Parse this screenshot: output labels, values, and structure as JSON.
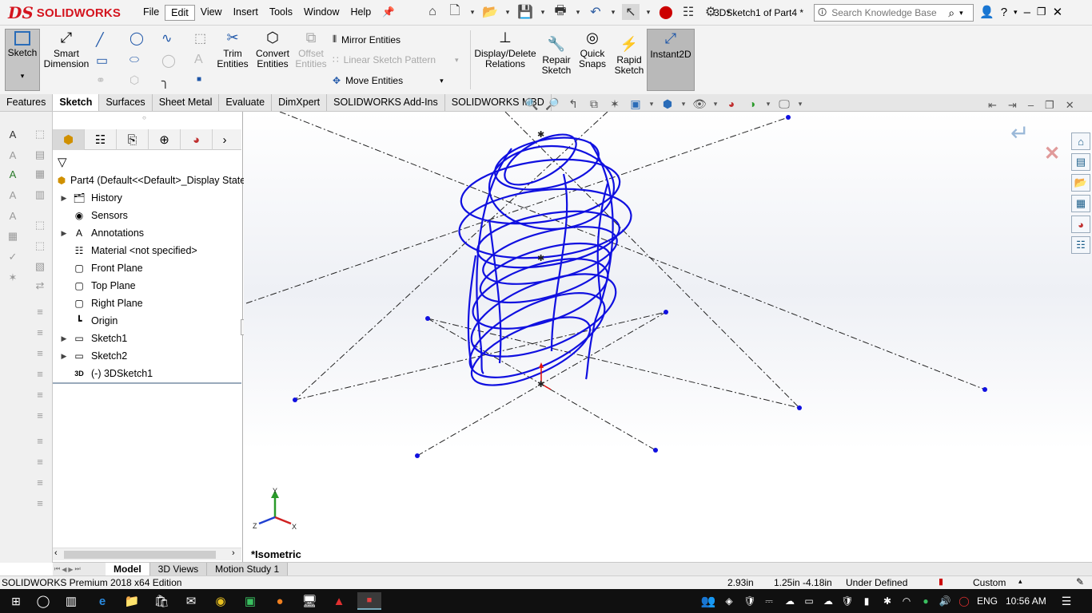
{
  "app": {
    "logo_ds": "DS",
    "logo_name": "SOLIDWORKS",
    "document_title": "3DSketch1 of Part4 *"
  },
  "menu": [
    "File",
    "Edit",
    "View",
    "Insert",
    "Tools",
    "Window",
    "Help"
  ],
  "search": {
    "placeholder": "Search Knowledge Base"
  },
  "ribbon": {
    "sketch": "Sketch",
    "smart_dimension": [
      "Smart",
      "Dimension"
    ],
    "trim_entities": [
      "Trim",
      "Entities"
    ],
    "convert_entities": [
      "Convert",
      "Entities"
    ],
    "offset_entities": [
      "Offset",
      "Entities"
    ],
    "mirror_entities": "Mirror Entities",
    "linear_sketch_pattern": "Linear Sketch Pattern",
    "move_entities": "Move Entities",
    "display_delete_relations": [
      "Display/Delete",
      "Relations"
    ],
    "repair_sketch": [
      "Repair",
      "Sketch"
    ],
    "quick_snaps": [
      "Quick",
      "Snaps"
    ],
    "rapid_sketch": [
      "Rapid",
      "Sketch"
    ],
    "instant2d": "Instant2D"
  },
  "command_tabs": [
    "Features",
    "Sketch",
    "Surfaces",
    "Sheet Metal",
    "Evaluate",
    "DimXpert",
    "SOLIDWORKS Add-Ins",
    "SOLIDWORKS MBD"
  ],
  "feature_tree": {
    "root": "Part4  (Default<<Default>_Display State",
    "items": [
      {
        "label": "History",
        "icon": "history-icon",
        "expandable": true
      },
      {
        "label": "Sensors",
        "icon": "sensors-icon",
        "expandable": false
      },
      {
        "label": "Annotations",
        "icon": "annotations-icon",
        "expandable": true
      },
      {
        "label": "Material <not specified>",
        "icon": "material-icon",
        "expandable": false
      },
      {
        "label": "Front Plane",
        "icon": "plane-icon",
        "expandable": false
      },
      {
        "label": "Top Plane",
        "icon": "plane-icon",
        "expandable": false
      },
      {
        "label": "Right Plane",
        "icon": "plane-icon",
        "expandable": false
      },
      {
        "label": "Origin",
        "icon": "origin-icon",
        "expandable": false
      },
      {
        "label": "Sketch1",
        "icon": "sketch-icon",
        "expandable": true
      },
      {
        "label": "Sketch2",
        "icon": "sketch-icon",
        "expandable": true
      },
      {
        "label": "(-) 3DSketch1",
        "icon": "3dsketch-icon",
        "expandable": false
      }
    ]
  },
  "viewport": {
    "view_name": "*Isometric",
    "triad": {
      "x": "X",
      "y": "Y",
      "z": "Z"
    },
    "sketch_color": "#1010e0"
  },
  "bottom_tabs": [
    "Model",
    "3D Views",
    "Motion Study 1"
  ],
  "status": {
    "edition": "SOLIDWORKS Premium 2018 x64 Edition",
    "length": "2.93in",
    "coords": "1.25in -4.18in",
    "state": "Under Defined",
    "units": "Custom"
  },
  "taskbar": {
    "language": "ENG",
    "time": "10:56 AM"
  }
}
